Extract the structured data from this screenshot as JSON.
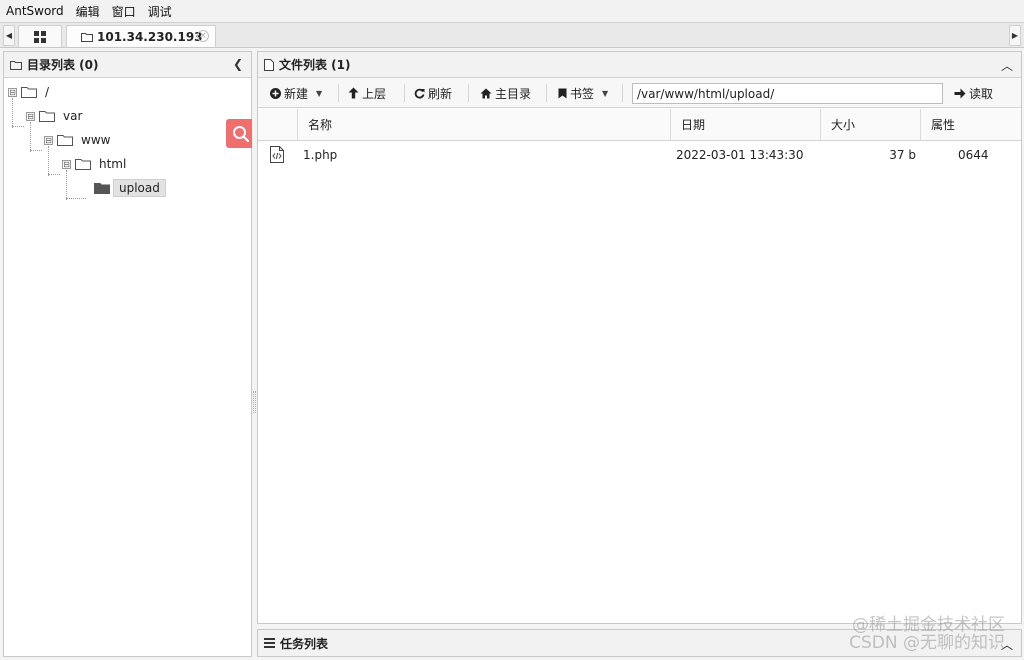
{
  "menu": {
    "items": [
      "AntSword",
      "编辑",
      "窗口",
      "调试"
    ]
  },
  "tabs": {
    "host_label": "101.34.230.193"
  },
  "dir_panel": {
    "title": "目录列表 (0)",
    "tree": [
      {
        "label": "/",
        "toggle": "⊟"
      },
      {
        "label": "var",
        "toggle": "⊟"
      },
      {
        "label": "www",
        "toggle": "⊟"
      },
      {
        "label": "html",
        "toggle": "⊟"
      },
      {
        "label": "upload",
        "toggle": ""
      }
    ]
  },
  "file_panel": {
    "title": "文件列表 (1)",
    "toolbar": {
      "new_label": "新建",
      "up_label": "上层",
      "refresh_label": "刷新",
      "home_label": "主目录",
      "bookmark_label": "书签",
      "path_value": "/var/www/html/upload/",
      "read_label": "读取"
    },
    "columns": [
      "名称",
      "日期",
      "大小",
      "属性"
    ],
    "rows": [
      {
        "name": "1.php",
        "date": "2022-03-01 13:43:30",
        "size": "37 b",
        "attr": "0644"
      }
    ]
  },
  "task_panel": {
    "title": "任务列表"
  },
  "watermark": {
    "line1": "@稀土掘金技术社区",
    "line2": "CSDN @无聊的知识"
  },
  "colors": {
    "search_accent": "#ef6e6e"
  }
}
